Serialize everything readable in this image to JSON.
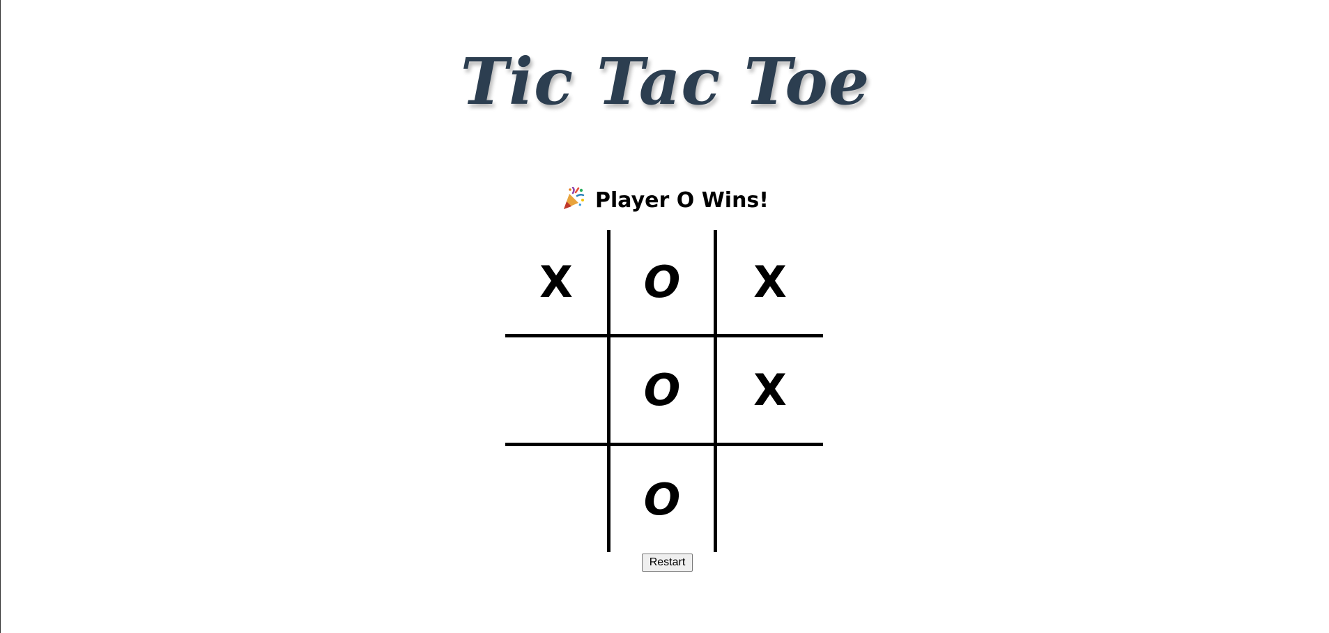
{
  "title": "Tic Tac Toe",
  "status": {
    "icon": "party-popper-icon",
    "text": "Player O Wins!"
  },
  "board": {
    "cells": [
      "X",
      "O",
      "X",
      "",
      "O",
      "X",
      "",
      "O",
      ""
    ]
  },
  "restart_label": "Restart",
  "colors": {
    "title": "#2c3e50",
    "lines": "#000000",
    "background": "#ffffff"
  }
}
